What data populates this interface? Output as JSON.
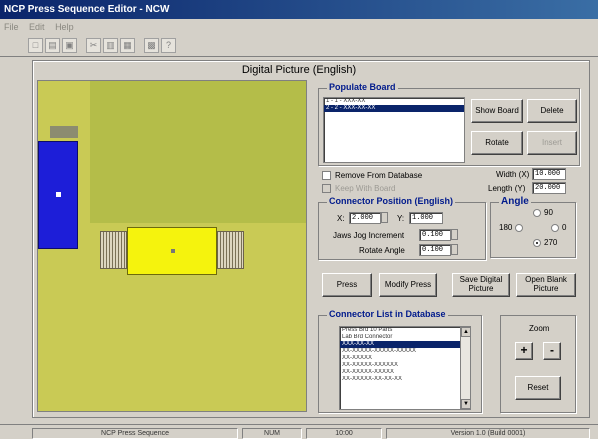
{
  "window": {
    "title": "NCP Press Sequence Editor - NCW"
  },
  "menu": [
    "File",
    "Edit",
    "Help"
  ],
  "toolbar": [
    {
      "icon": "new-icon",
      "glyph": "□"
    },
    {
      "icon": "open-icon",
      "glyph": "▤"
    },
    {
      "icon": "save-icon",
      "glyph": "▣"
    },
    {
      "icon": "cut-icon",
      "glyph": "✂"
    },
    {
      "icon": "copy-icon",
      "glyph": "▥"
    },
    {
      "icon": "paste-icon",
      "glyph": "▦"
    },
    {
      "icon": "print-icon",
      "glyph": "▩"
    },
    {
      "icon": "help-icon",
      "glyph": "?"
    }
  ],
  "header": "Digital Picture (English)",
  "populate_board": {
    "title": "Populate Board",
    "items": [
      {
        "text": "1 - 1 - XXX-XX",
        "selected": false
      },
      {
        "text": "2 - 2 - XXX-XX-XX",
        "selected": true
      }
    ],
    "buttons": {
      "show_board": "Show Board",
      "delete": "Delete",
      "rotate": "Rotate",
      "insert": "Insert"
    }
  },
  "options": {
    "remove_from_database": "Remove From Database",
    "keep_with_board": "Keep With Board"
  },
  "board_size": {
    "width_label": "Width (X)",
    "width_value": "10.000",
    "length_label": "Length (Y)",
    "length_value": "20.000"
  },
  "connector_position": {
    "title": "Connector Position (English)",
    "x_label": "X:",
    "x_value": "2.000",
    "y_label": "Y:",
    "y_value": "1.000",
    "jog1_label": "Jaws Jog Increment",
    "jog1_value": "0.100",
    "jog2_label": "Rotate Angle",
    "jog2_value": "0.100"
  },
  "angle": {
    "title": "Angle",
    "options": [
      {
        "label": "90",
        "checked": false
      },
      {
        "label": "180",
        "checked": false
      },
      {
        "label": "0",
        "checked": false
      },
      {
        "label": "270",
        "checked": true
      }
    ]
  },
  "actions": {
    "press": "Press",
    "modify_press": "Modify Press",
    "save_digital": "Save Digital Picture",
    "open_blank": "Open Blank Picture"
  },
  "connector_list": {
    "title": "Connector List in Database",
    "items": [
      {
        "text": "Press Brd 10 Parts",
        "selected": false
      },
      {
        "text": "Lab Brd Connector",
        "selected": false
      },
      {
        "text": "XXX-XX-XX",
        "selected": true
      },
      {
        "text": "XX-XXXXX-XXXXX-XXXXX",
        "selected": false
      },
      {
        "text": "XX-XXXXX",
        "selected": false
      },
      {
        "text": "XX-XXXXX-XXXXXX",
        "selected": false
      },
      {
        "text": "XX-XXXXX-XXXXX",
        "selected": false
      },
      {
        "text": "XX-XXXXX-XX-XX-XX",
        "selected": false
      }
    ]
  },
  "zoom": {
    "title": "Zoom",
    "plus": "+",
    "minus": "-",
    "reset": "Reset"
  },
  "status": [
    "NCP Press Sequence",
    "NUM",
    "10:00",
    "Version 1.0 (Build 0001)"
  ],
  "colors": {
    "title_bar": "#0a246a",
    "board": "#c9ca55",
    "connector_blue": "#1d1ed8",
    "connector_yellow": "#f5f30d",
    "selection": "#0a246a",
    "group_title": "#001a8c"
  }
}
